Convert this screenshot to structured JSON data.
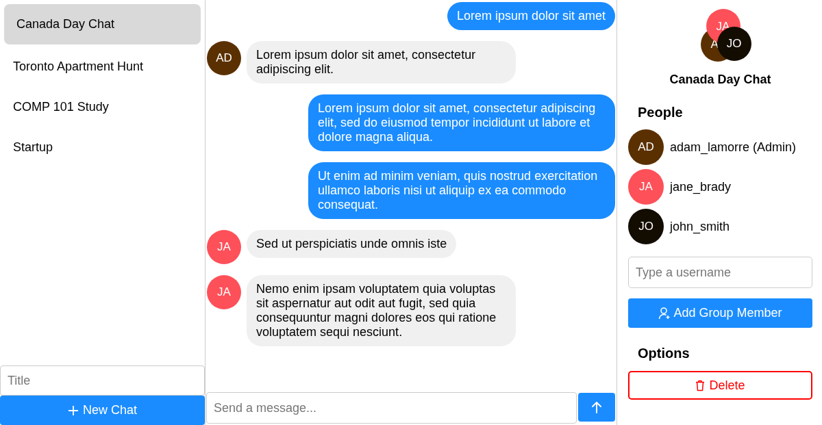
{
  "chats": [
    {
      "title": "Canada Day Chat",
      "selected": true
    },
    {
      "title": "Toronto Apartment Hunt",
      "selected": false
    },
    {
      "title": "COMP 101 Study",
      "selected": false
    },
    {
      "title": "Startup",
      "selected": false
    }
  ],
  "new_chat": {
    "placeholder": "Title",
    "button": "New Chat"
  },
  "messages": [
    {
      "kind": "outgoing",
      "text": "Lorem ipsum dolor sit amet"
    },
    {
      "kind": "incoming",
      "initials": "AD",
      "color": "#5a3000",
      "text": "Lorem ipsum dolor sit amet, consectetur adipiscing elit."
    },
    {
      "kind": "outgoing",
      "text": "Lorem ipsum dolor sit amet, consectetur adipiscing elit, sed do eiusmod tempor incididunt ut labore et dolore magna aliqua."
    },
    {
      "kind": "outgoing",
      "text": "Ut enim ad minim veniam, quis nostrud exercitation ullamco laboris nisi ut aliquip ex ea commodo consequat."
    },
    {
      "kind": "incoming",
      "initials": "JA",
      "color": "#fe5059",
      "text": "Sed ut perspiciatis unde omnis iste"
    },
    {
      "kind": "incoming",
      "initials": "JA",
      "color": "#fe5059",
      "text": "Nemo enim ipsam voluptatem quia voluptas sit aspernatur aut odit aut fugit, sed quia consequuntur magni dolores eos qui ratione voluptatem sequi nesciunt."
    }
  ],
  "composer": {
    "placeholder": "Send a message..."
  },
  "details": {
    "group_avatars": [
      {
        "initials": "A",
        "color": "#5a3000"
      },
      {
        "initials": "JA",
        "color": "#fe5059"
      },
      {
        "initials": "JO",
        "color": "#130c00"
      }
    ],
    "title": "Canada Day Chat",
    "people_heading": "People",
    "people": [
      {
        "initials": "AD",
        "color": "#5a3000",
        "name": "adam_lamorre (Admin)"
      },
      {
        "initials": "JA",
        "color": "#fe5059",
        "name": "jane_brady"
      },
      {
        "initials": "JO",
        "color": "#130c00",
        "name": "john_smith"
      }
    ],
    "username_placeholder": "Type a username",
    "add_button": "Add Group Member",
    "options_heading": "Options",
    "delete_button": "Delete"
  }
}
